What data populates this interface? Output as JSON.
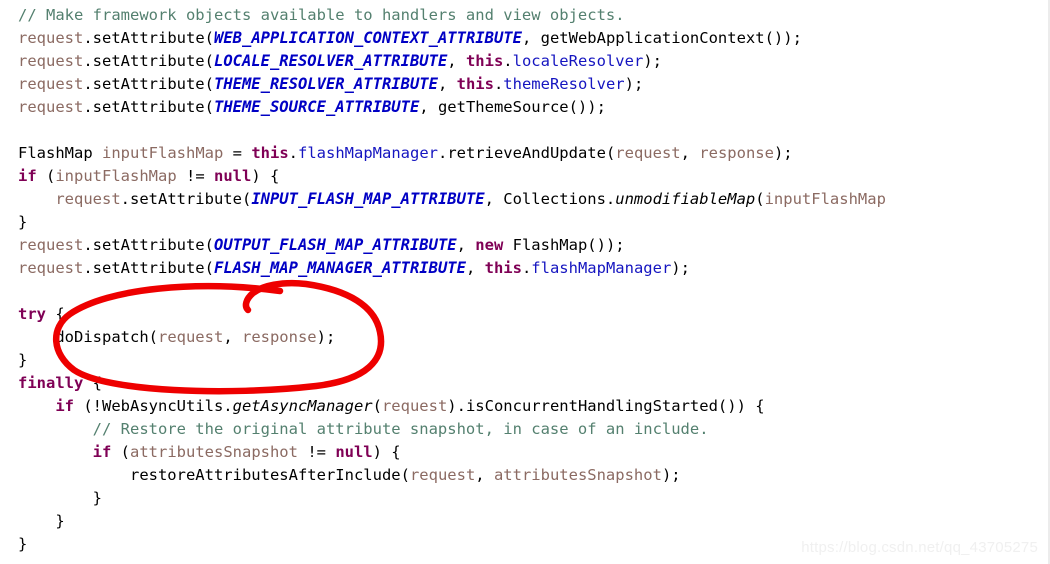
{
  "editor": {
    "background_color": "#ffffff",
    "font_size_px": 15.5,
    "line_height_px": 23,
    "colors": {
      "comment": "#54806f",
      "keyword": "#7f0055",
      "variable": "#8b6a62",
      "constant": "#0000c4",
      "field": "#1515c0",
      "method": "#000000",
      "plain": "#000000",
      "annotation_red": "#ee0000"
    },
    "lines": [
      {
        "indent": 0,
        "tokens": [
          {
            "t": "// Make framework objects available to handlers and view objects.",
            "c": "cmt"
          }
        ]
      },
      {
        "indent": 0,
        "tokens": [
          {
            "t": "request",
            "c": "var"
          },
          {
            "t": ".",
            "c": "pln"
          },
          {
            "t": "setAttribute",
            "c": "pln"
          },
          {
            "t": "(",
            "c": "pln"
          },
          {
            "t": "WEB_APPLICATION_CONTEXT_ATTRIBUTE",
            "c": "cons"
          },
          {
            "t": ", getWebApplicationContext());",
            "c": "pln"
          }
        ]
      },
      {
        "indent": 0,
        "tokens": [
          {
            "t": "request",
            "c": "var"
          },
          {
            "t": ".setAttribute(",
            "c": "pln"
          },
          {
            "t": "LOCALE_RESOLVER_ATTRIBUTE",
            "c": "cons"
          },
          {
            "t": ", ",
            "c": "pln"
          },
          {
            "t": "this",
            "c": "kw"
          },
          {
            "t": ".",
            "c": "pln"
          },
          {
            "t": "localeResolver",
            "c": "fld"
          },
          {
            "t": ");",
            "c": "pln"
          }
        ]
      },
      {
        "indent": 0,
        "tokens": [
          {
            "t": "request",
            "c": "var"
          },
          {
            "t": ".setAttribute(",
            "c": "pln"
          },
          {
            "t": "THEME_RESOLVER_ATTRIBUTE",
            "c": "cons"
          },
          {
            "t": ", ",
            "c": "pln"
          },
          {
            "t": "this",
            "c": "kw"
          },
          {
            "t": ".",
            "c": "pln"
          },
          {
            "t": "themeResolver",
            "c": "fld"
          },
          {
            "t": ");",
            "c": "pln"
          }
        ]
      },
      {
        "indent": 0,
        "tokens": [
          {
            "t": "request",
            "c": "var"
          },
          {
            "t": ".setAttribute(",
            "c": "pln"
          },
          {
            "t": "THEME_SOURCE_ATTRIBUTE",
            "c": "cons"
          },
          {
            "t": ", getThemeSource());",
            "c": "pln"
          }
        ]
      },
      {
        "indent": 0,
        "tokens": []
      },
      {
        "indent": 0,
        "tokens": [
          {
            "t": "FlashMap ",
            "c": "pln"
          },
          {
            "t": "inputFlashMap",
            "c": "var"
          },
          {
            "t": " = ",
            "c": "pln"
          },
          {
            "t": "this",
            "c": "kw"
          },
          {
            "t": ".",
            "c": "pln"
          },
          {
            "t": "flashMapManager",
            "c": "fld"
          },
          {
            "t": ".retrieveAndUpdate(",
            "c": "pln"
          },
          {
            "t": "request",
            "c": "var"
          },
          {
            "t": ", ",
            "c": "pln"
          },
          {
            "t": "response",
            "c": "var"
          },
          {
            "t": ");",
            "c": "pln"
          }
        ]
      },
      {
        "indent": 0,
        "tokens": [
          {
            "t": "if",
            "c": "kw"
          },
          {
            "t": " (",
            "c": "pln"
          },
          {
            "t": "inputFlashMap",
            "c": "var"
          },
          {
            "t": " != ",
            "c": "pln"
          },
          {
            "t": "null",
            "c": "kw"
          },
          {
            "t": ") {",
            "c": "pln"
          }
        ]
      },
      {
        "indent": 1,
        "tokens": [
          {
            "t": "request",
            "c": "var"
          },
          {
            "t": ".setAttribute(",
            "c": "pln"
          },
          {
            "t": "INPUT_FLASH_MAP_ATTRIBUTE",
            "c": "cons"
          },
          {
            "t": ", Collections.",
            "c": "pln"
          },
          {
            "t": "unmodifiableMap",
            "c": "mth"
          },
          {
            "t": "(",
            "c": "pln"
          },
          {
            "t": "inputFlashMap",
            "c": "var"
          }
        ]
      },
      {
        "indent": 0,
        "tokens": [
          {
            "t": "}",
            "c": "pln"
          }
        ]
      },
      {
        "indent": 0,
        "tokens": [
          {
            "t": "request",
            "c": "var"
          },
          {
            "t": ".setAttribute(",
            "c": "pln"
          },
          {
            "t": "OUTPUT_FLASH_MAP_ATTRIBUTE",
            "c": "cons"
          },
          {
            "t": ", ",
            "c": "pln"
          },
          {
            "t": "new",
            "c": "kw"
          },
          {
            "t": " FlashMap());",
            "c": "pln"
          }
        ]
      },
      {
        "indent": 0,
        "tokens": [
          {
            "t": "request",
            "c": "var"
          },
          {
            "t": ".setAttribute(",
            "c": "pln"
          },
          {
            "t": "FLASH_MAP_MANAGER_ATTRIBUTE",
            "c": "cons"
          },
          {
            "t": ", ",
            "c": "pln"
          },
          {
            "t": "this",
            "c": "kw"
          },
          {
            "t": ".",
            "c": "pln"
          },
          {
            "t": "flashMapManager",
            "c": "fld"
          },
          {
            "t": ");",
            "c": "pln"
          }
        ]
      },
      {
        "indent": 0,
        "tokens": []
      },
      {
        "indent": 0,
        "tokens": [
          {
            "t": "try",
            "c": "kw"
          },
          {
            "t": " {",
            "c": "pln"
          }
        ]
      },
      {
        "indent": 1,
        "tokens": [
          {
            "t": "doDispatch(",
            "c": "pln"
          },
          {
            "t": "request",
            "c": "var"
          },
          {
            "t": ", ",
            "c": "pln"
          },
          {
            "t": "response",
            "c": "var"
          },
          {
            "t": ");",
            "c": "pln"
          }
        ]
      },
      {
        "indent": 0,
        "tokens": [
          {
            "t": "}",
            "c": "pln"
          }
        ]
      },
      {
        "indent": 0,
        "tokens": [
          {
            "t": "finally",
            "c": "kw"
          },
          {
            "t": " {",
            "c": "pln"
          }
        ]
      },
      {
        "indent": 1,
        "tokens": [
          {
            "t": "if",
            "c": "kw"
          },
          {
            "t": " (!WebAsyncUtils.",
            "c": "pln"
          },
          {
            "t": "getAsyncManager",
            "c": "mth"
          },
          {
            "t": "(",
            "c": "pln"
          },
          {
            "t": "request",
            "c": "var"
          },
          {
            "t": ").isConcurrentHandlingStarted()) {",
            "c": "pln"
          }
        ]
      },
      {
        "indent": 2,
        "tokens": [
          {
            "t": "// Restore the original attribute snapshot, in case of an include.",
            "c": "cmt"
          }
        ]
      },
      {
        "indent": 2,
        "tokens": [
          {
            "t": "if",
            "c": "kw"
          },
          {
            "t": " (",
            "c": "pln"
          },
          {
            "t": "attributesSnapshot",
            "c": "var"
          },
          {
            "t": " != ",
            "c": "pln"
          },
          {
            "t": "null",
            "c": "kw"
          },
          {
            "t": ") {",
            "c": "pln"
          }
        ]
      },
      {
        "indent": 3,
        "tokens": [
          {
            "t": "restoreAttributesAfterInclude(",
            "c": "pln"
          },
          {
            "t": "request",
            "c": "var"
          },
          {
            "t": ", ",
            "c": "pln"
          },
          {
            "t": "attributesSnapshot",
            "c": "var"
          },
          {
            "t": ");",
            "c": "pln"
          }
        ]
      },
      {
        "indent": 2,
        "tokens": [
          {
            "t": "}",
            "c": "pln"
          }
        ]
      },
      {
        "indent": 1,
        "tokens": [
          {
            "t": "}",
            "c": "pln"
          }
        ]
      },
      {
        "indent": 0,
        "tokens": [
          {
            "t": "}",
            "c": "pln"
          }
        ]
      }
    ]
  },
  "annotation": {
    "shape": "hand-drawn-red-ellipse",
    "color": "#ee0000",
    "encircles": "doDispatch(request, response);"
  },
  "watermark": {
    "text": "https://blog.csdn.net/qq_43705275"
  }
}
